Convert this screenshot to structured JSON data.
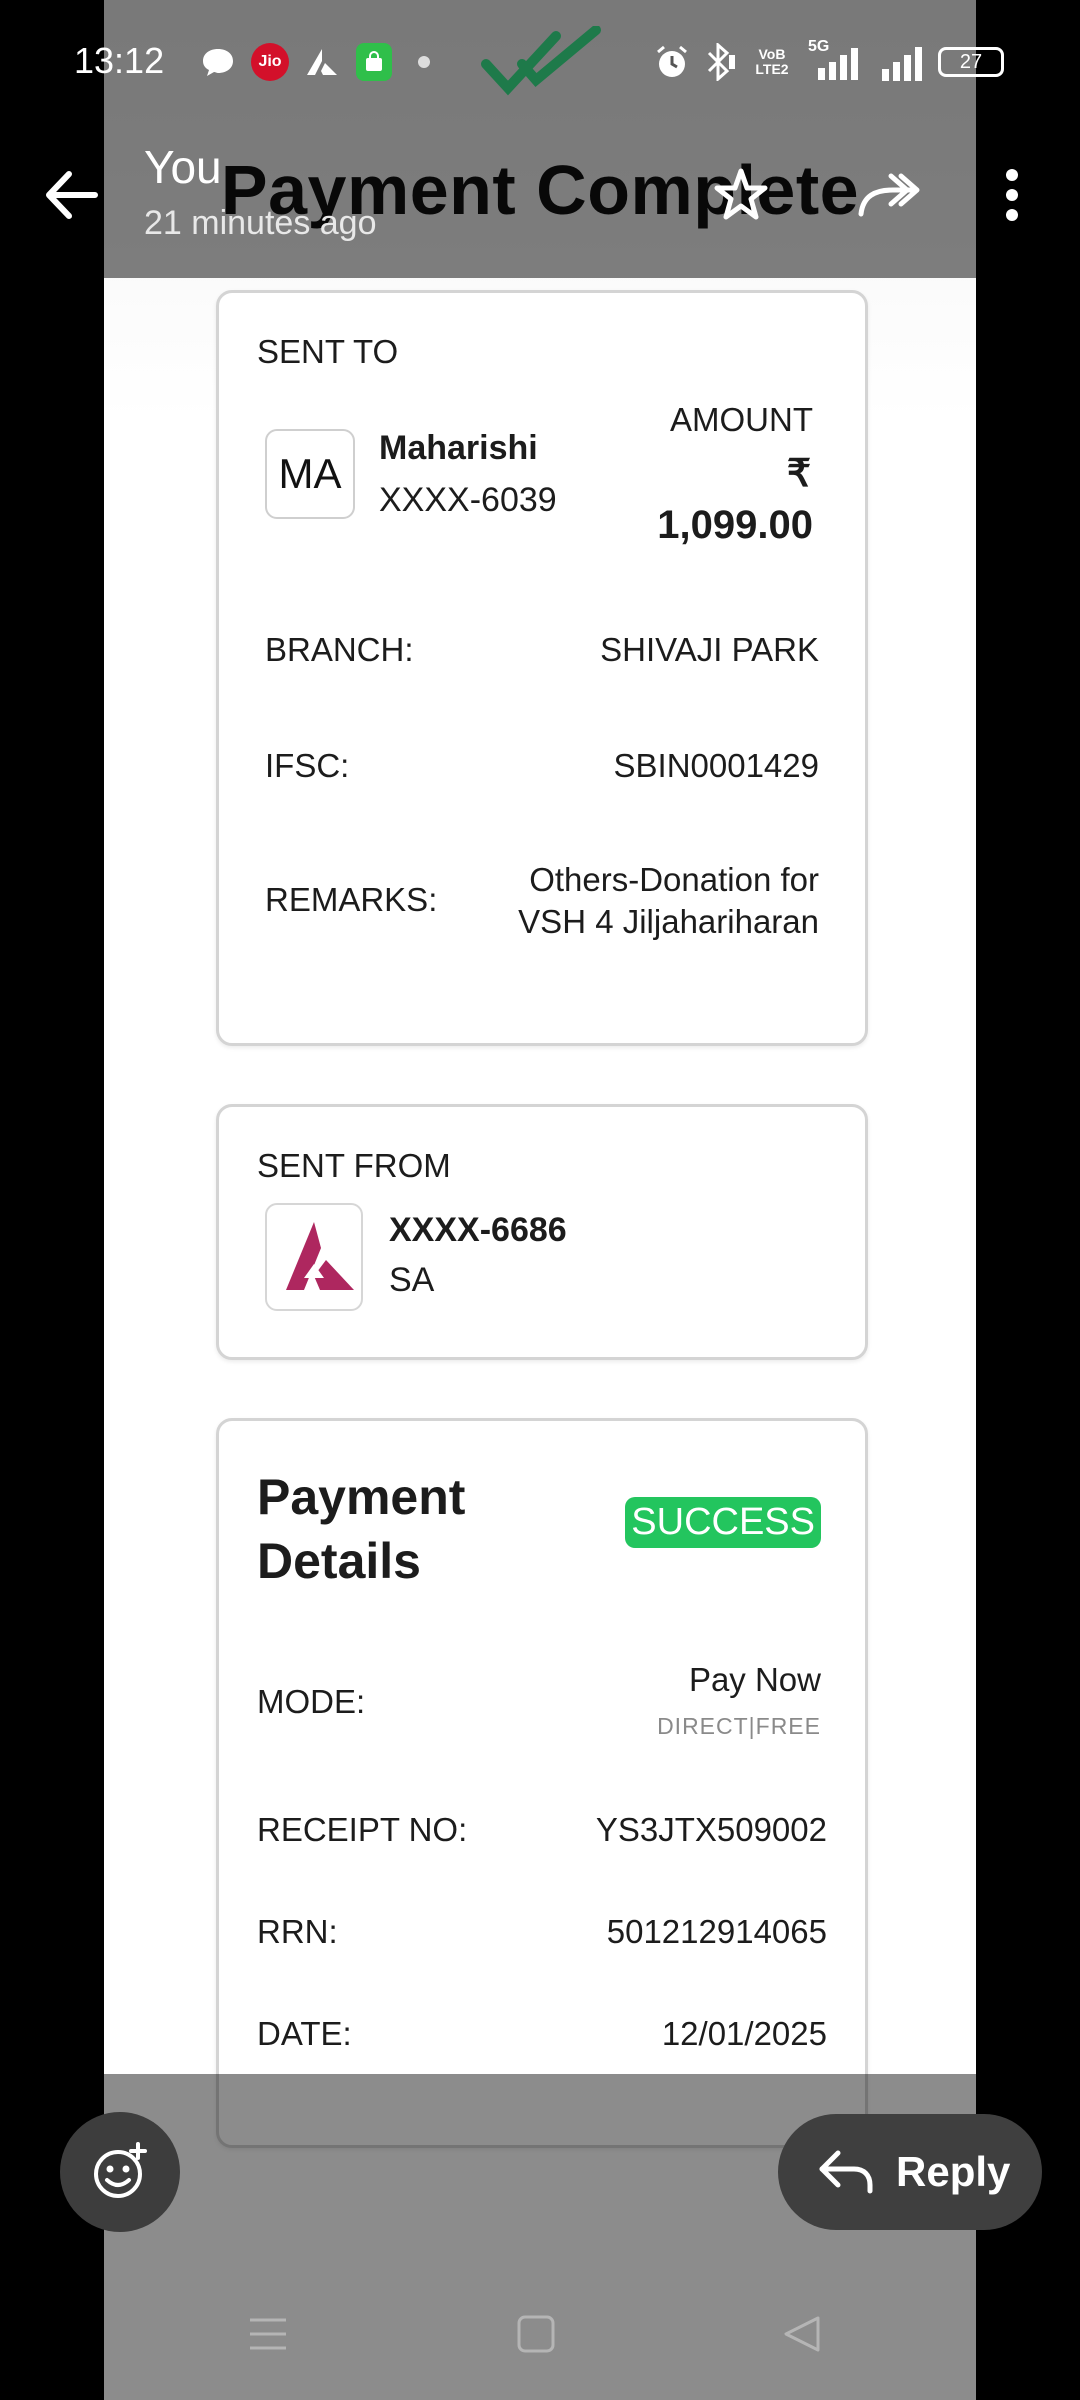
{
  "status_bar": {
    "time": "13:12",
    "carrier": "Jio",
    "network_lte": "VoB\nLTE2",
    "network_5g": "5G",
    "battery": "27"
  },
  "header": {
    "sender": "You",
    "timestamp": "21 minutes ago"
  },
  "receipt": {
    "title": "Payment Complete",
    "sent_to": {
      "label": "SENT TO",
      "avatar_initials": "MA",
      "name": "Maharishi",
      "account": "XXXX-6039",
      "amount_label": "AMOUNT",
      "currency": "₹",
      "amount": "1,099.00",
      "branch_label": "BRANCH:",
      "branch": "SHIVAJI PARK",
      "ifsc_label": "IFSC:",
      "ifsc": "SBIN0001429",
      "remarks_label": "REMARKS:",
      "remarks_line1": "Others-Donation for",
      "remarks_line2": "VSH 4 Jiljahariharan"
    },
    "sent_from": {
      "label": "SENT FROM",
      "account": "XXXX-6686",
      "name": "SA"
    },
    "payment_details": {
      "title_line1": "Payment",
      "title_line2": "Details",
      "status": "SUCCESS",
      "mode_label": "MODE:",
      "mode": "Pay Now",
      "mode_sub": "DIRECT|FREE",
      "receipt_label": "RECEIPT NO:",
      "receipt": "YS3JTX509002",
      "rrn_label": "RRN:",
      "rrn": "501212914065",
      "date_label": "DATE:",
      "date": "12/01/2025"
    }
  },
  "actions": {
    "reply_label": "Reply"
  },
  "colors": {
    "success": "#23c55e",
    "bank_logo": "#ae275f",
    "check_logo": "#1e7a4a"
  },
  "icons": [
    "back-arrow-icon",
    "star-icon",
    "forward-icon",
    "more-vert-icon",
    "emoji-add-icon",
    "reply-arrow-icon",
    "menu-icon",
    "home-square-icon",
    "back-triangle-icon"
  ]
}
